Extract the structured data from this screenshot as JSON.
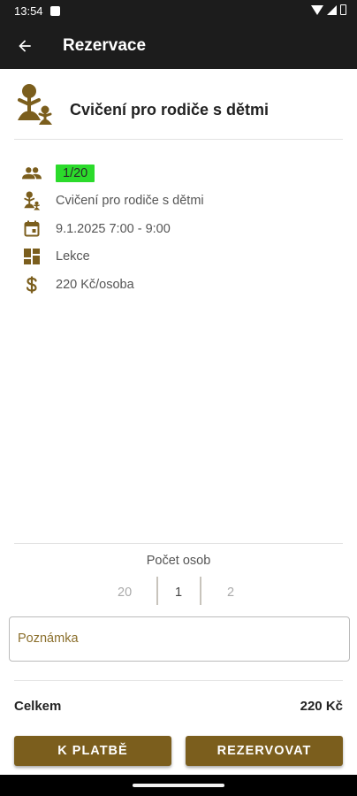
{
  "status_bar": {
    "time": "13:54"
  },
  "app_bar": {
    "title": "Rezervace"
  },
  "header": {
    "title": "Cvičení pro rodiče s dětmi"
  },
  "details": {
    "capacity": "1/20",
    "activity": "Cvičení pro rodiče s dětmi",
    "datetime": "9.1.2025 7:00 - 9:00",
    "type": "Lekce",
    "price": "220 Kč/osoba"
  },
  "persons": {
    "label": "Počet osob",
    "options": [
      "20",
      "1",
      "2"
    ],
    "selected": "1"
  },
  "note": {
    "placeholder": "Poznámka"
  },
  "total": {
    "label": "Celkem",
    "value": "220 Kč"
  },
  "buttons": {
    "pay": "K PLATBĚ",
    "reserve": "REZERVOVAT"
  },
  "colors": {
    "accent": "#7b5e1d",
    "badge": "#2bdb2b",
    "bar": "#1c1c1c"
  },
  "icons": [
    "back-arrow-icon",
    "yoga-icon",
    "people-icon",
    "calendar-icon",
    "dashboard-icon",
    "dollar-icon"
  ]
}
